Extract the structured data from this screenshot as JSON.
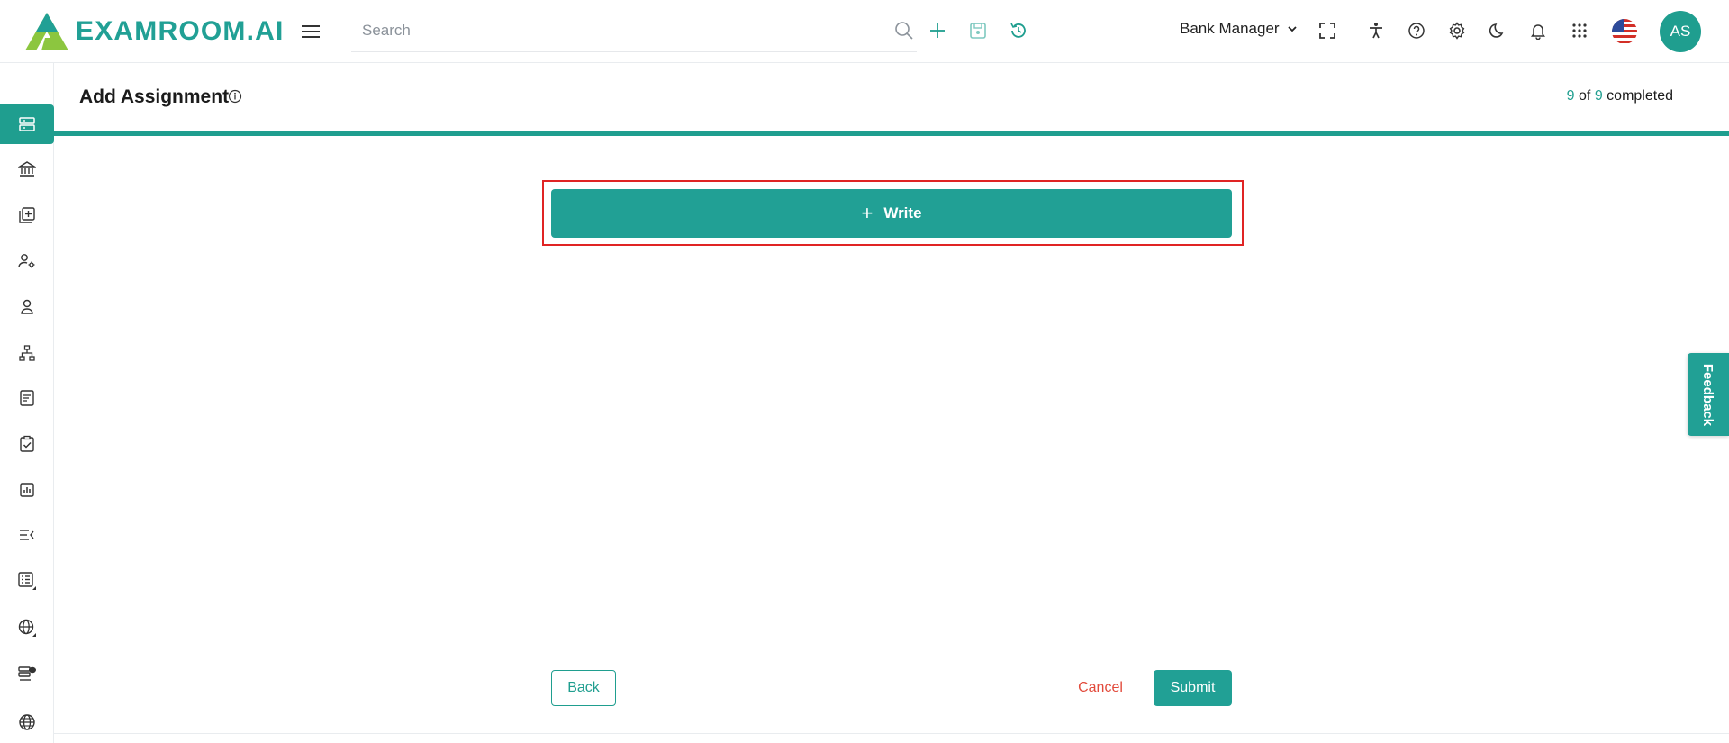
{
  "app": {
    "logo_text": "EXAMROOM.AI",
    "brand_color": "#21a095"
  },
  "topbar": {
    "search_placeholder": "Search",
    "role_label": "Bank Manager",
    "avatar_initials": "AS",
    "icons": [
      "search-icon",
      "plus-icon",
      "save-icon",
      "history-icon",
      "fullscreen-icon",
      "accessibility-icon",
      "help-icon",
      "settings-icon",
      "dark-mode-icon",
      "bell-icon",
      "apps-grid-icon",
      "us-flag-icon"
    ]
  },
  "sidebar": {
    "items": [
      "dashboard-icon",
      "bank-icon",
      "add-library-icon",
      "user-settings-icon",
      "candidate-icon",
      "hierarchy-icon",
      "form-icon",
      "checklist-icon",
      "report-icon",
      "menu-collapse-icon",
      "list-icon",
      "globe-settings-icon",
      "server-chat-icon",
      "globe-icon"
    ],
    "active_index": 0
  },
  "page": {
    "title": "Add Assignment",
    "progress": {
      "done": "9",
      "of_word": "of",
      "total": "9",
      "suffix": "completed",
      "fraction": 1.0
    }
  },
  "main": {
    "write_label": "Write",
    "write_plus": "+"
  },
  "actions": {
    "back_label": "Back",
    "cancel_label": "Cancel",
    "submit_label": "Submit"
  },
  "feedback_label": "Feedback",
  "colors": {
    "accent": "#21a095",
    "cancel": "#e24a3b",
    "highlight": "#e02424"
  }
}
